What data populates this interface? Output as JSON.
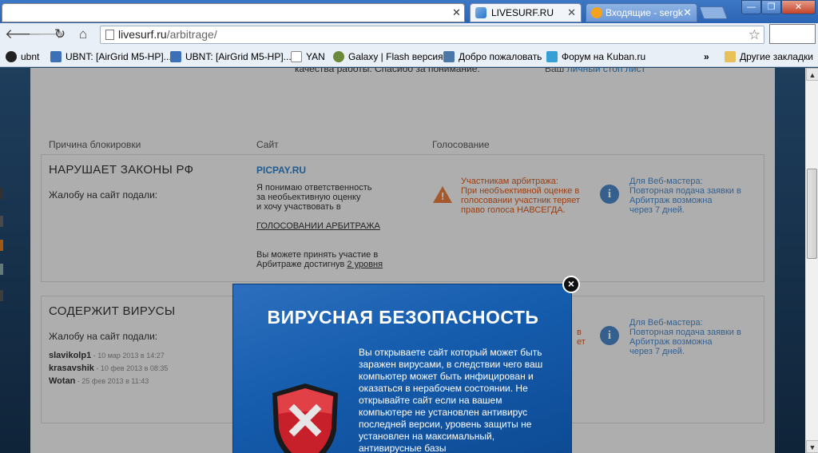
{
  "tabs": [
    {
      "label": ""
    },
    {
      "label": "LIVESURF.RU"
    },
    {
      "label": "Входящие - sergk"
    }
  ],
  "address": {
    "domain": "livesurf.ru",
    "path": "/arbitrage/"
  },
  "bookmarks": [
    {
      "label": "ubnt"
    },
    {
      "label": "UBNT: [AirGrid M5-HP]..."
    },
    {
      "label": "UBNT: [AirGrid M5-HP]..."
    },
    {
      "label": "YAN"
    },
    {
      "label": "Galaxy | Flash версия"
    },
    {
      "label": "Добро пожаловать"
    },
    {
      "label": "Форум на Kuban.ru"
    }
  ],
  "bookmarks_more": "»",
  "other_bookmarks": "Другие закладки",
  "page": {
    "top_text": "качества работы. Спасибо за понимание.",
    "top_right_text": "Ваш",
    "top_right_link": "личный стоп лист",
    "col_reason": "Причина блокировки",
    "col_site": "Сайт",
    "col_vote": "Голосование",
    "entries": [
      {
        "reason": "НАРУШАЕТ ЗАКОНЫ РФ",
        "complaint_label": "Жалобу на сайт подали:",
        "site": "PICPAY.RU",
        "agree_line1": "Я понимаю ответственность",
        "agree_line2": "за необьективную оценку",
        "agree_line3": "и хочу участвовать в",
        "agree_link": "ГОЛОСОВАНИИ АРБИТРАЖА",
        "note_line1": "Вы можете принять участие в",
        "note_line2": "Арбитраже достигнув",
        "note_link": "2 уровня",
        "warn_line1": "Участникам арбитража:",
        "warn_line2": "При необъективной оценке в",
        "warn_line3": "голосовании участник теряет",
        "warn_line4": "право голоса НАВСЕГДА.",
        "info_line1": "Для Веб-мастера:",
        "info_line2": "Повторная подача заявки в",
        "info_line3": "Арбитраж возможна",
        "info_line4": "через 7 дней."
      },
      {
        "reason": "СОДЕРЖИТ ВИРУСЫ",
        "complaint_label": "Жалобу на сайт подали:",
        "reporters": [
          {
            "name": "slavikolp1",
            "date": " - 10 мар 2013 в 14:27"
          },
          {
            "name": "krasavshik",
            "date": " - 10 фев 2013 в 08:35"
          },
          {
            "name": "Wotan",
            "date": " - 25 фев 2013 в 11:43"
          }
        ],
        "warn_partial_1": "в",
        "warn_partial_2": "ет",
        "info_line1": "Для Веб-мастера:",
        "info_line2": "Повторная подача заявки в",
        "info_line3": "Арбитраж возможна",
        "info_line4": "через 7 дней."
      }
    ]
  },
  "popup": {
    "title": "ВИРУСНАЯ БЕЗОПАСНОСТЬ",
    "text": "Вы открываете сайт который может быть заражен вирусами, в следствии чего ваш компьютер может быть инфицирован и оказаться в нерабочем состоянии. Не открывайте сайт если на вашем компьютере не установлен антивирус последней версии, уровень защиты не установлен на максимальный, антивирусные базы",
    "close": "×"
  }
}
